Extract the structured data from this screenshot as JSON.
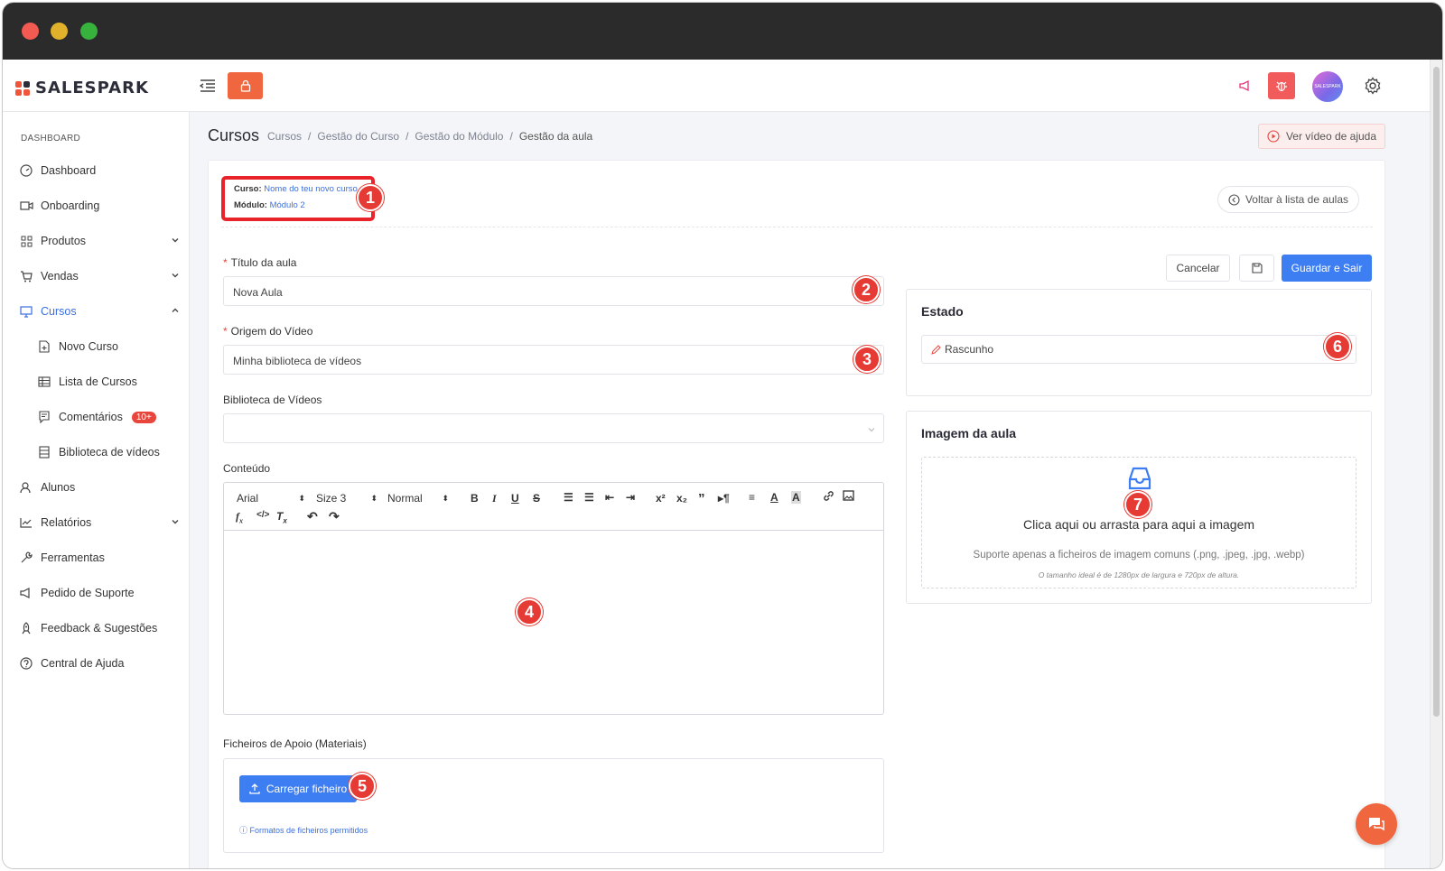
{
  "brand": {
    "name": "SALESPARK"
  },
  "topbar": {
    "avatar_text": "SALESPARK"
  },
  "sidebar": {
    "section": "DASHBOARD",
    "items": [
      {
        "label": "Dashboard"
      },
      {
        "label": "Onboarding"
      },
      {
        "label": "Produtos"
      },
      {
        "label": "Vendas"
      },
      {
        "label": "Cursos"
      },
      {
        "label": "Novo Curso"
      },
      {
        "label": "Lista de Cursos"
      },
      {
        "label": "Comentários",
        "badge": "10+"
      },
      {
        "label": "Biblioteca de vídeos"
      },
      {
        "label": "Alunos"
      },
      {
        "label": "Relatórios"
      },
      {
        "label": "Ferramentas"
      },
      {
        "label": "Pedido de Suporte"
      },
      {
        "label": "Feedback & Sugestões"
      },
      {
        "label": "Central de Ajuda"
      }
    ]
  },
  "header": {
    "title": "Cursos",
    "breadcrumb": [
      "Cursos",
      "Gestão do Curso",
      "Gestão do Módulo",
      "Gestão da aula"
    ],
    "separator": "/",
    "help_button": "Ver vídeo de ajuda"
  },
  "context": {
    "course_label": "Curso:",
    "course_value": "Nome do teu novo curso",
    "module_label": "Módulo:",
    "module_value": "Módulo 2",
    "back_button": "Voltar à lista de aulas"
  },
  "form": {
    "title_label": "Título da aula",
    "title_value": "Nova Aula",
    "origin_label": "Origem do Vídeo",
    "origin_value": "Minha biblioteca de vídeos",
    "library_label": "Biblioteca de Vídeos",
    "library_value": "",
    "content_label": "Conteúdo",
    "editor": {
      "font": "Arial",
      "size": "Size 3",
      "style": "Normal"
    },
    "files_label": "Ficheiros de Apoio (Materiais)",
    "upload_button": "Carregar ficheiro",
    "formats_link": "Formatos de ficheiros permitidos"
  },
  "actions": {
    "cancel": "Cancelar",
    "save_exit": "Guardar e Sair"
  },
  "state_panel": {
    "title": "Estado",
    "value": "Rascunho"
  },
  "image_panel": {
    "title": "Imagem da aula",
    "dropzone_title": "Clica aqui ou arrasta para aqui a imagem",
    "dropzone_sub": "Suporte apenas a ficheiros de imagem comuns (.png, .jpeg, .jpg, .webp)",
    "dropzone_hint": "O tamanho ideal é de 1280px de largura e 720px de altura."
  },
  "markers": [
    "1",
    "2",
    "3",
    "4",
    "5",
    "6",
    "7"
  ],
  "colors": {
    "accent": "#3d7ef2",
    "brand": "#f0663f",
    "marker": "#e63b35"
  }
}
